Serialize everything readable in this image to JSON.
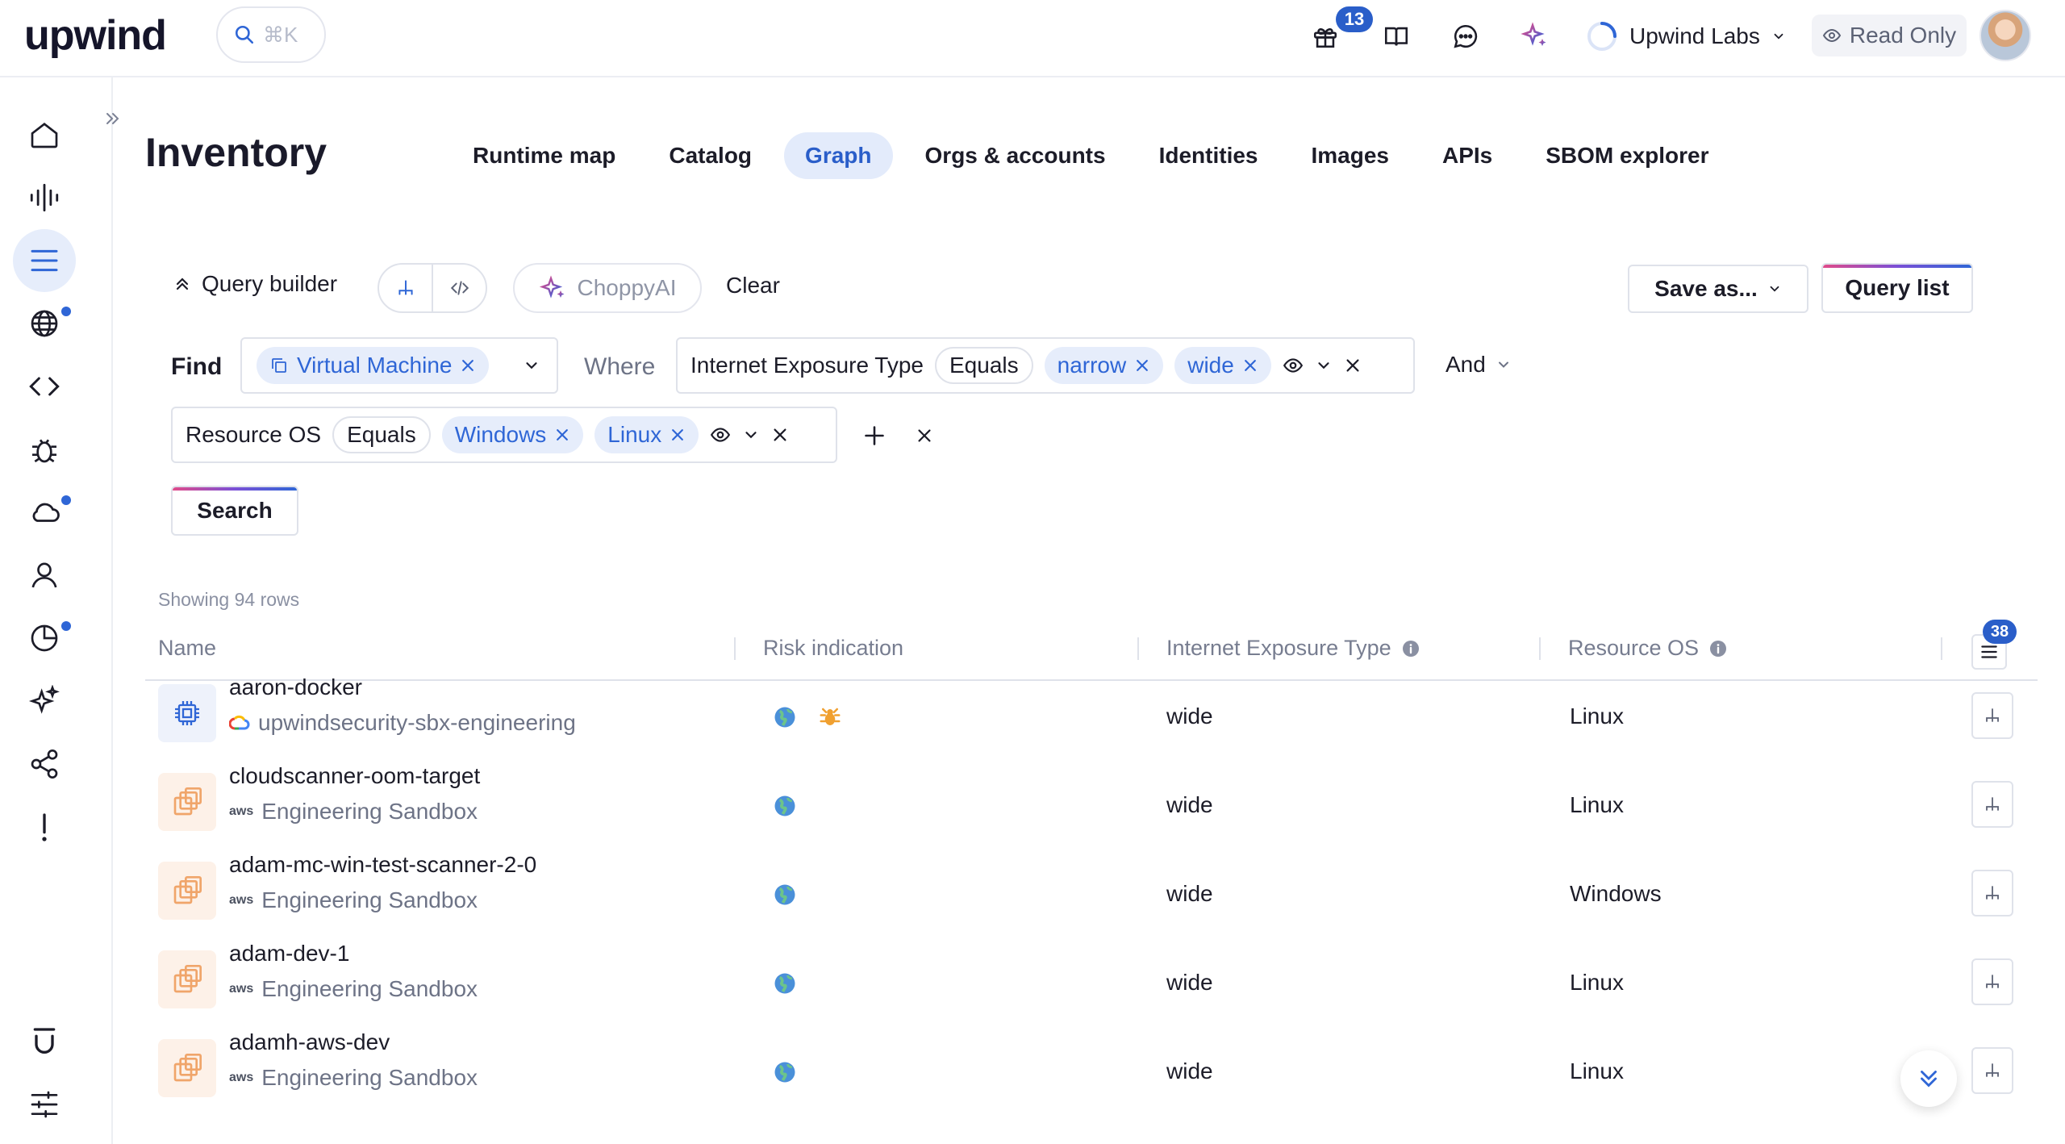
{
  "brand": {
    "logo_text": "upwind"
  },
  "search": {
    "shortcut": "⌘K"
  },
  "topbar": {
    "notifications_count": "13",
    "org_name": "Upwind Labs",
    "read_only_label": "Read Only"
  },
  "page": {
    "title": "Inventory"
  },
  "tabs": [
    {
      "label": "Runtime map"
    },
    {
      "label": "Catalog"
    },
    {
      "label": "Graph",
      "active": true
    },
    {
      "label": "Orgs & accounts"
    },
    {
      "label": "Identities"
    },
    {
      "label": "Images"
    },
    {
      "label": "APIs"
    },
    {
      "label": "SBOM explorer"
    }
  ],
  "query": {
    "builder_label": "Query builder",
    "ai_label": "ChoppyAI",
    "clear_label": "Clear",
    "save_as_label": "Save as...",
    "query_list_label": "Query list",
    "find_label": "Find",
    "find_value": "Virtual Machine",
    "where_label": "Where",
    "condition1": {
      "field": "Internet Exposure Type",
      "operator": "Equals",
      "values": [
        "narrow",
        "wide"
      ]
    },
    "combinator": "And",
    "condition2": {
      "field": "Resource OS",
      "operator": "Equals",
      "values": [
        "Windows",
        "Linux"
      ]
    },
    "search_label": "Search"
  },
  "table": {
    "row_count_label": "Showing 94 rows",
    "columns": [
      "Name",
      "Risk indication",
      "Internet Exposure Type",
      "Resource OS"
    ],
    "column_settings_badge": "38",
    "rows": [
      {
        "name": "aaron-docker",
        "account": "upwindsecurity-sbx-engineering",
        "provider": "gcp",
        "exposure": "wide",
        "os": "Linux"
      },
      {
        "name": "cloudscanner-oom-target",
        "account": "Engineering Sandbox",
        "provider": "aws",
        "exposure": "wide",
        "os": "Linux"
      },
      {
        "name": "adam-mc-win-test-scanner-2-0",
        "account": "Engineering Sandbox",
        "provider": "aws",
        "exposure": "wide",
        "os": "Windows"
      },
      {
        "name": "adam-dev-1",
        "account": "Engineering Sandbox",
        "provider": "aws",
        "exposure": "wide",
        "os": "Linux"
      },
      {
        "name": "adamh-aws-dev",
        "account": "Engineering Sandbox",
        "provider": "aws",
        "exposure": "wide",
        "os": "Linux"
      }
    ]
  },
  "provider_labels": {
    "aws": "aws"
  },
  "colors": {
    "accent": "#2a5ec9",
    "chip_bg": "#e6edfb",
    "ec2_orange": "#f0a56a"
  }
}
